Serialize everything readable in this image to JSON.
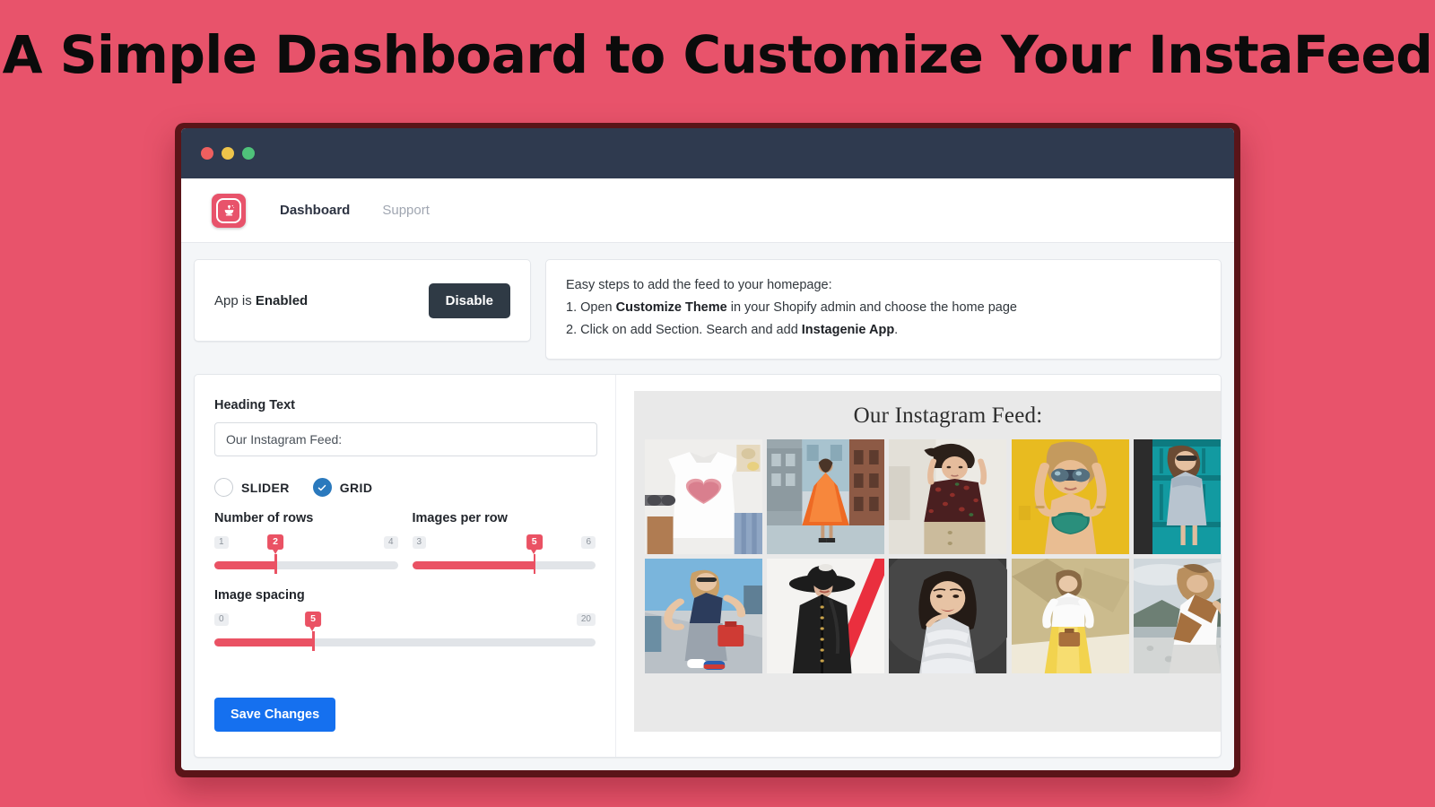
{
  "banner": {
    "title": "A Simple Dashboard to Customize Your InstaFeed",
    "background_color": "#e8536b",
    "title_color": "#0b0b0b"
  },
  "window": {
    "frame_color": "#5a1418",
    "titlebar_color": "#2f3a4f",
    "traffic_lights": [
      {
        "name": "close",
        "color": "#ef5f5f"
      },
      {
        "name": "minimize",
        "color": "#eec44a"
      },
      {
        "name": "maximize",
        "color": "#4fc27a"
      }
    ]
  },
  "nav": {
    "logo_icon": "genie-lamp-icon",
    "logo_color": "#e8536b",
    "links": [
      {
        "label": "Dashboard",
        "active": true
      },
      {
        "label": "Support",
        "active": false
      }
    ]
  },
  "status_card": {
    "prefix": "App is ",
    "state": "Enabled",
    "button_label": "Disable",
    "button_color": "#2f3a45"
  },
  "steps_card": {
    "intro": "Easy steps to add the feed to your homepage:",
    "steps": [
      {
        "number": "1. ",
        "pre": "Open ",
        "bold": "Customize Theme",
        "post": " in your Shopify admin and choose the home page"
      },
      {
        "number": "2. ",
        "pre": "Click on add Section. Search and add ",
        "bold": "Instagenie App",
        "post": "."
      }
    ]
  },
  "form": {
    "heading_label": "Heading Text",
    "heading_value": "Our Instagram Feed:",
    "heading_placeholder": "Our Instagram Feed:",
    "layout_options": [
      {
        "label": "SLIDER",
        "selected": false
      },
      {
        "label": "GRID",
        "selected": true
      }
    ],
    "selected_color": "#2a79bd",
    "sliders": [
      {
        "name": "rows",
        "title": "Number of rows",
        "min": "1",
        "max": "4",
        "value": "2",
        "percent": 33.3
      },
      {
        "name": "images-per-row",
        "title": "Images per row",
        "min": "3",
        "max": "6",
        "value": "5",
        "percent": 66.6
      },
      {
        "name": "image-spacing",
        "title": "Image spacing",
        "min": "0",
        "max": "20",
        "value": "5",
        "percent": 25.9
      }
    ],
    "slider_accent": "#ea5264",
    "save_label": "Save Changes",
    "save_color": "#1570ef"
  },
  "preview": {
    "heading": "Our Instagram Feed:",
    "background": "#e9e9e9",
    "rows": 2,
    "columns": 5,
    "photos": [
      {
        "id": "p1",
        "alt": "white t-shirt with pink heart flat-lay"
      },
      {
        "id": "p2",
        "alt": "woman in orange dress on city street"
      },
      {
        "id": "p3",
        "alt": "woman in dark floral top against white wall"
      },
      {
        "id": "p4",
        "alt": "woman with sunglasses on yellow wall"
      },
      {
        "id": "p5",
        "alt": "woman in grey dress against teal door"
      },
      {
        "id": "p6",
        "alt": "woman on stairs with red bag under blue sky"
      },
      {
        "id": "p7",
        "alt": "woman in black hat and coat on white and red backdrop"
      },
      {
        "id": "p8",
        "alt": "studio portrait on dark grey backdrop"
      },
      {
        "id": "p9",
        "alt": "woman in white top and yellow skirt on rocks"
      },
      {
        "id": "p10",
        "alt": "woman in brown and white top by the lake"
      }
    ]
  }
}
